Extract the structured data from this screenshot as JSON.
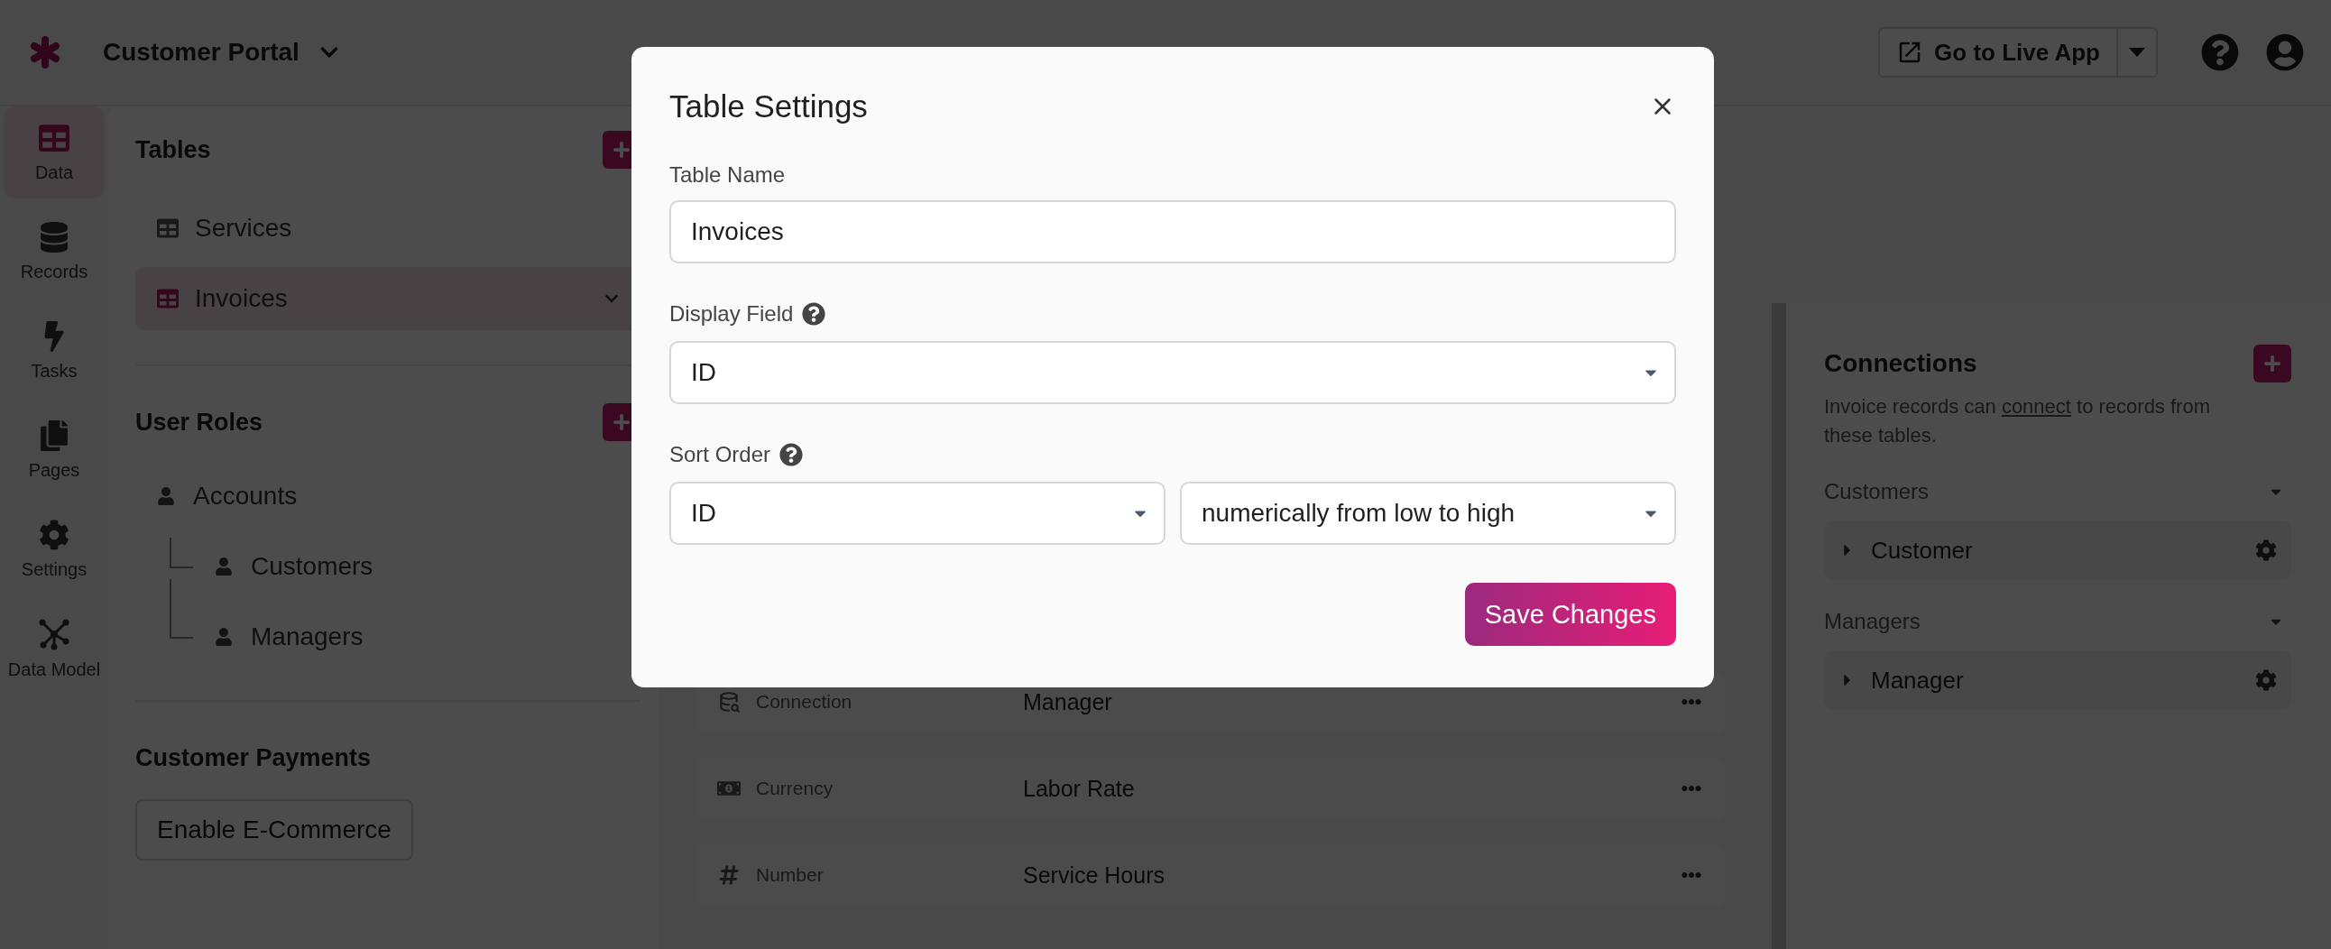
{
  "topbar": {
    "app_name": "Customer Portal",
    "live_button": "Go to Live App"
  },
  "nav": [
    {
      "label": "Data",
      "selected": true
    },
    {
      "label": "Records",
      "selected": false
    },
    {
      "label": "Tasks",
      "selected": false
    },
    {
      "label": "Pages",
      "selected": false
    },
    {
      "label": "Settings",
      "selected": false
    },
    {
      "label": "Data Model",
      "selected": false
    }
  ],
  "sidebar": {
    "tables": {
      "title": "Tables",
      "items": [
        {
          "label": "Services",
          "selected": false
        },
        {
          "label": "Invoices",
          "selected": true
        }
      ]
    },
    "user_roles": {
      "title": "User Roles",
      "items": [
        {
          "label": "Accounts",
          "children": [
            {
              "label": "Customers"
            },
            {
              "label": "Managers"
            }
          ]
        }
      ]
    },
    "payments": {
      "title": "Customer Payments",
      "button": "Enable E-Commerce"
    }
  },
  "fields": [
    {
      "kind": "connection",
      "type": "Connection",
      "name": "Manager"
    },
    {
      "kind": "currency",
      "type": "Currency",
      "name": "Labor Rate"
    },
    {
      "kind": "number",
      "type": "Number",
      "name": "Service Hours"
    }
  ],
  "connections": {
    "title": "Connections",
    "description": {
      "before": "Invoice records can ",
      "link": "connect",
      "after": " to records from these tables."
    },
    "groups": [
      {
        "title": "Customers",
        "items": [
          {
            "label": "Customer",
            "expanded": false
          }
        ]
      },
      {
        "title": "Managers",
        "items": [
          {
            "label": "Manager",
            "expanded": false
          }
        ]
      }
    ]
  },
  "modal": {
    "title": "Table Settings",
    "table_name": {
      "label": "Table Name",
      "value": "Invoices"
    },
    "display_field": {
      "label": "Display Field",
      "value": "ID"
    },
    "sort_order": {
      "label": "Sort Order",
      "field": "ID",
      "direction": "numerically from low to high"
    },
    "save_button": "Save Changes"
  }
}
